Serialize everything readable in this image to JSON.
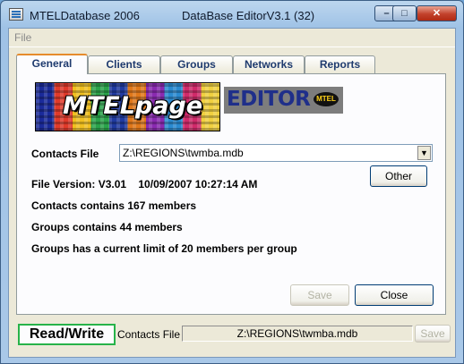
{
  "window": {
    "app_title": "MTELDatabase 2006",
    "editor_title": "DataBase EditorV3.1 (32)",
    "minimize": "–",
    "maximize": "□",
    "close": "✕"
  },
  "menu": {
    "file": "File"
  },
  "tabs": [
    {
      "label": "General",
      "active": true
    },
    {
      "label": "Clients"
    },
    {
      "label": "Groups"
    },
    {
      "label": "Networks"
    },
    {
      "label": "Reports"
    }
  ],
  "logo": {
    "text": "MTELpage",
    "editor": "EDITOR",
    "badge": "MTEL"
  },
  "general": {
    "contacts_file_label": "Contacts File",
    "contacts_file_value": "Z:\\REGIONS\\twmba.mdb",
    "file_version": "File Version: V3.01    10/09/2007 10:27:14 AM",
    "contacts_info": "Contacts contains 167 members",
    "groups_info": "Groups contains 44 members",
    "limit_info": "Groups has a current limit of 20 members per group",
    "other_button": "Other",
    "save_button": "Save",
    "close_button": "Close"
  },
  "status": {
    "mode": "Read/Write",
    "contacts_label": "Contacts File",
    "contacts_value": "Z:\\REGIONS\\twmba.mdb",
    "save_button": "Save"
  }
}
